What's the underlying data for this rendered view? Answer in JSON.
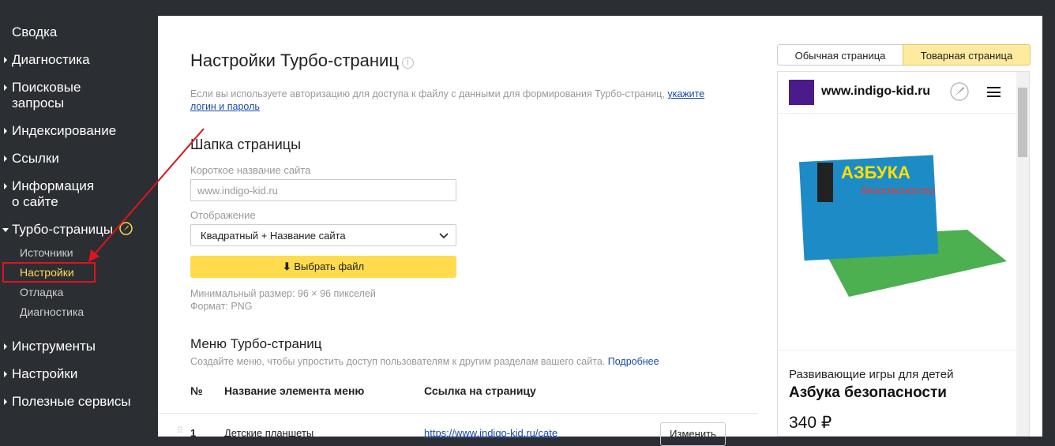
{
  "sidebar": {
    "items": [
      "Сводка",
      "Диагностика",
      "Поисковые\nзапросы",
      "Индексирование",
      "Ссылки",
      "Информация\nо сайте",
      "Турбо-страницы",
      "Инструменты",
      "Настройки",
      "Полезные сервисы"
    ],
    "sub": [
      "Источники",
      "Настройки",
      "Отладка",
      "Диагностика"
    ]
  },
  "main": {
    "title": "Настройки Турбо-страниц",
    "info": "i",
    "auth_hint": "Если вы используете авторизацию для доступа к файлу с данными для формирования Турбо-страниц,",
    "auth_link1": "укажите",
    "auth_link2": "логин и пароль",
    "header_title": "Шапка страницы",
    "short_name_label": "Короткое название сайта",
    "short_name_placeholder": "www.indigo-kid.ru",
    "display_label": "Отображение",
    "display_value": "Квадратный + Название сайта",
    "upload": "Выбрать файл",
    "min_size": "Минимальный размер: 96 × 96 пикселей",
    "format": "Формат: PNG",
    "menu_title": "Меню Турбо-страниц",
    "menu_hint": "Создайте меню, чтобы упростить доступ пользователям к другим разделам вашего сайта.",
    "menu_more": "Подробнее",
    "columns": [
      "№",
      "Название элемента меню",
      "Ссылка на страницу"
    ],
    "rows": [
      {
        "n": "1",
        "name": "Детские планшеты",
        "url": "https://www.indigo-kid.ru/cate",
        "edit": "Изменить"
      }
    ]
  },
  "preview": {
    "tabs": [
      "Обычная страница",
      "Товарная страница"
    ],
    "active_tab": 1,
    "site": "www.indigo-kid.ru",
    "product_box_title": "АЗБУКА",
    "product_box_sub": "безопасности",
    "category": "Развивающие игры для детей",
    "product": "Азбука безопасности",
    "price": "340 ₽"
  },
  "colors": {
    "sidebar_bg": "#2b2e33",
    "accent": "#ffdb4d",
    "active_nav": "#ffdb4d",
    "highlight": "#e0141e"
  }
}
